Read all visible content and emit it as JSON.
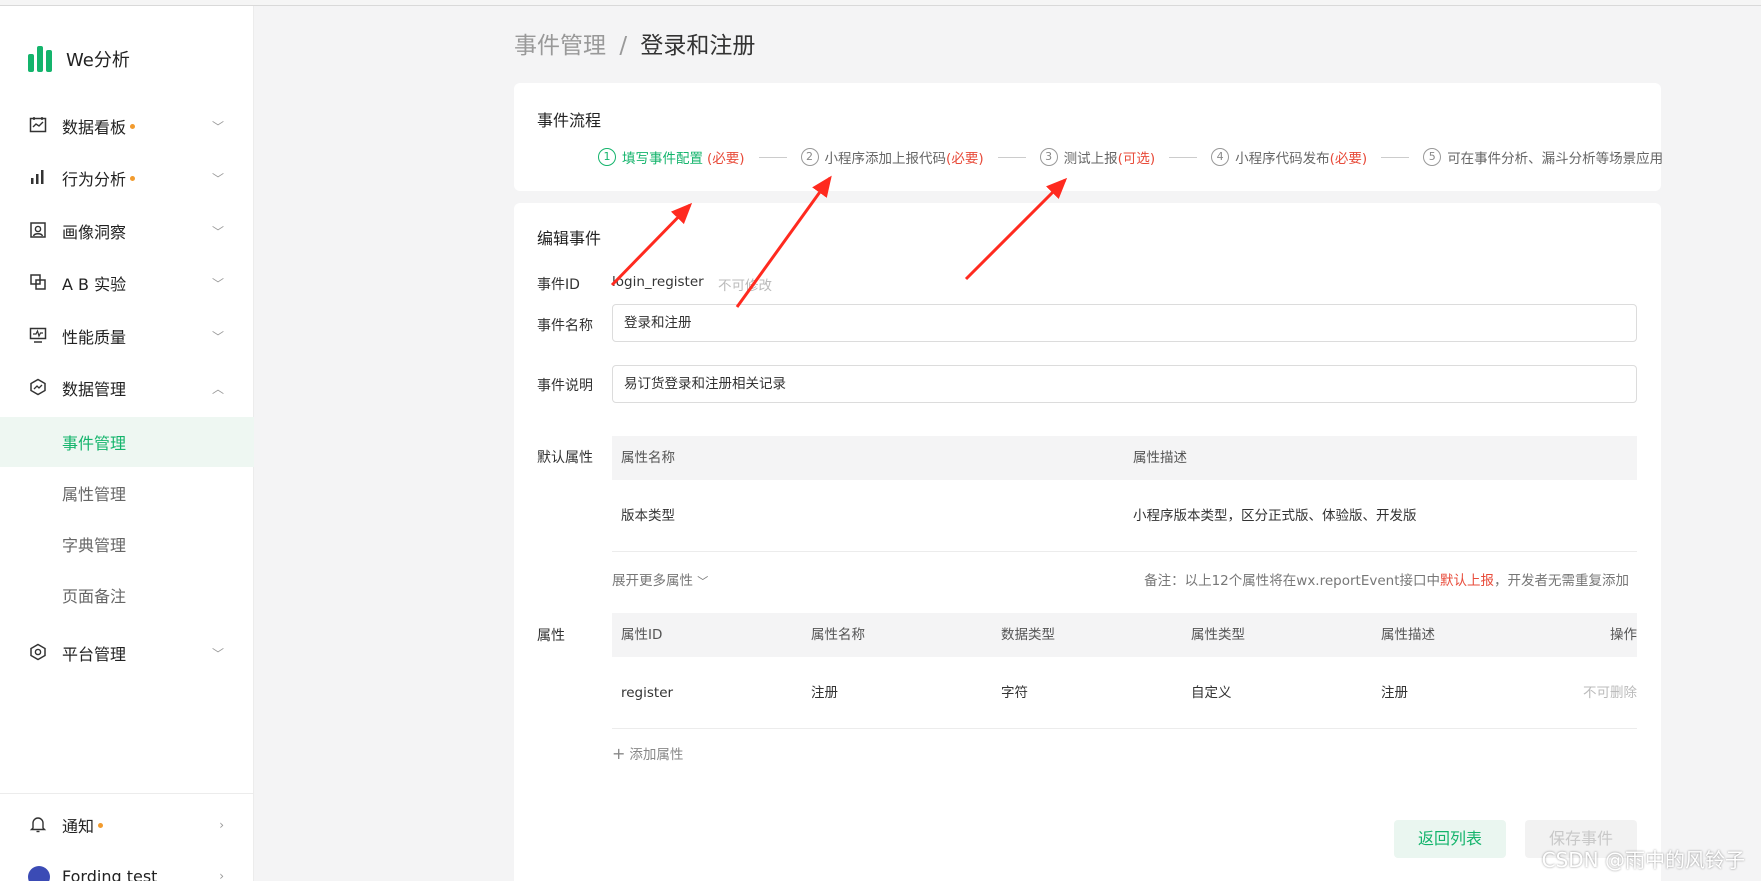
{
  "app": {
    "name": "We分析"
  },
  "sidebar": {
    "items": [
      {
        "label": "数据看板",
        "icon": "dashboard-icon",
        "dot": true,
        "chevron": "﹀"
      },
      {
        "label": "行为分析",
        "icon": "bar-chart-icon",
        "dot": true,
        "chevron": "﹀"
      },
      {
        "label": "画像洞察",
        "icon": "portrait-icon",
        "dot": false,
        "chevron": "﹀"
      },
      {
        "label": "A B 实验",
        "icon": "ab-test-icon",
        "dot": false,
        "chevron": "﹀"
      },
      {
        "label": "性能质量",
        "icon": "monitor-icon",
        "dot": false,
        "chevron": "﹀"
      },
      {
        "label": "数据管理",
        "icon": "data-manage-icon",
        "dot": false,
        "chevron": "︿"
      }
    ],
    "sub_items": [
      "事件管理",
      "属性管理",
      "字典管理",
      "页面备注"
    ],
    "platform": {
      "label": "平台管理",
      "icon": "settings-icon"
    },
    "notify": {
      "label": "通知",
      "icon": "bell-icon"
    },
    "user": {
      "label": "Fording test"
    }
  },
  "breadcrumb": {
    "parent": "事件管理",
    "separator": "/",
    "current": "登录和注册"
  },
  "flow": {
    "title": "事件流程",
    "steps": [
      {
        "num": "1",
        "label": "填写事件配置",
        "tag": "(必要)"
      },
      {
        "num": "2",
        "label": "小程序添加上报代码",
        "tag": "(必要)"
      },
      {
        "num": "3",
        "label": "测试上报",
        "tag": "(可选)"
      },
      {
        "num": "4",
        "label": "小程序代码发布",
        "tag": "(必要)"
      },
      {
        "num": "5",
        "label": "可在事件分析、漏斗分析等场景应用",
        "tag": ""
      }
    ]
  },
  "edit": {
    "title": "编辑事件",
    "id_label": "事件ID",
    "id_value": "login_register",
    "id_hint": "不可修改",
    "name_label": "事件名称",
    "name_value": "登录和注册",
    "desc_label": "事件说明",
    "desc_value": "易订货登录和注册相关记录",
    "default_attr_label": "默认属性",
    "default_table": {
      "headers": [
        "属性名称",
        "属性描述"
      ],
      "rows": [
        [
          "版本类型",
          "小程序版本类型，区分正式版、体验版、开发版"
        ]
      ]
    },
    "expand_label": "展开更多属性",
    "note_prefix": "备注：以上12个属性将在wx.reportEvent接口中",
    "note_highlight": "默认上报",
    "note_suffix": "，开发者无需重复添加",
    "attr_label": "属性",
    "attr_table": {
      "headers": [
        "属性ID",
        "属性名称",
        "数据类型",
        "属性类型",
        "属性描述",
        "操作"
      ],
      "rows": [
        [
          "register",
          "注册",
          "字符",
          "自定义",
          "注册",
          "不可删除"
        ]
      ]
    },
    "add_attr_label": "添加属性",
    "back_button": "返回列表",
    "save_button": "保存事件"
  },
  "watermark": "CSDN @雨中的风铃子",
  "colors": {
    "accent": "#14b46c",
    "required": "#e84b3a",
    "annotation_arrow": "#ff2a1f",
    "dot": "#f29b2e"
  }
}
